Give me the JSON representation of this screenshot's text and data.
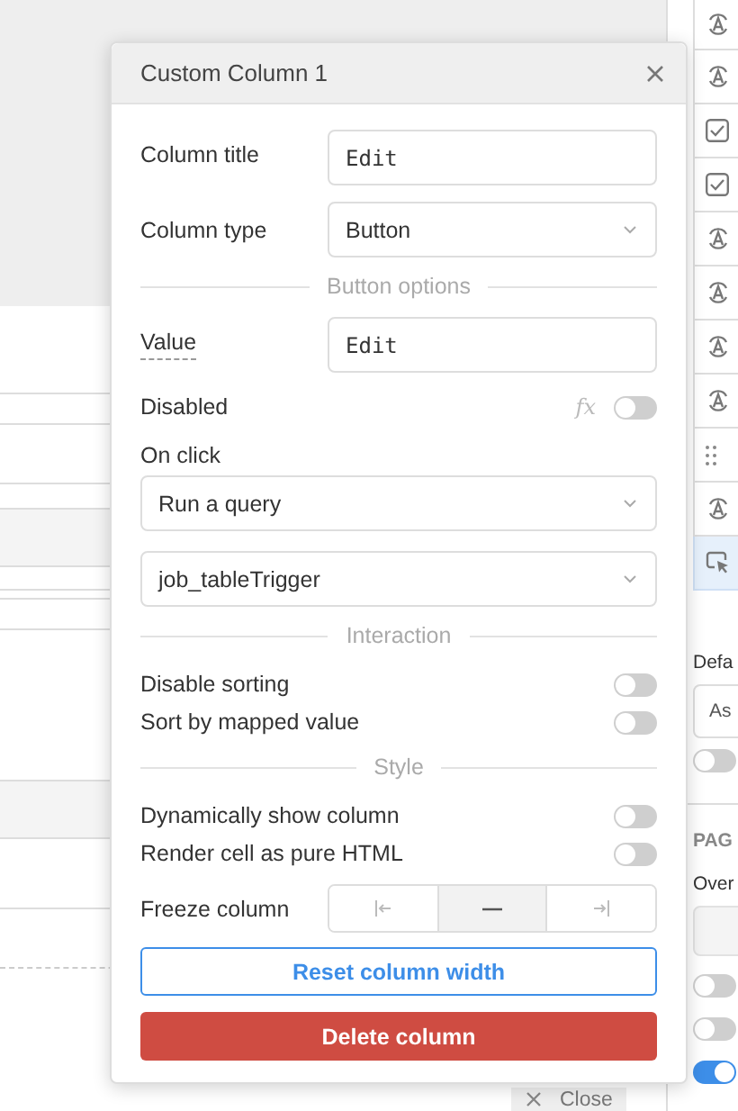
{
  "popup": {
    "title": "Custom Column 1",
    "rows": [
      {
        "kind": "input",
        "label": "Column title",
        "value": "Edit",
        "hint": false
      },
      {
        "kind": "select",
        "label": "Column type",
        "value": "Button"
      },
      {
        "kind": "section",
        "label": "Button options"
      },
      {
        "kind": "input",
        "label": "Value",
        "value": "Edit",
        "hint": true
      },
      {
        "kind": "toggle",
        "label": "Disabled",
        "on": false,
        "formula": "fx"
      },
      {
        "kind": "label",
        "label": "On click"
      },
      {
        "kind": "wide_select",
        "value": "Run a query"
      },
      {
        "kind": "wide_select",
        "value": "job_tableTrigger"
      },
      {
        "kind": "section",
        "label": "Interaction"
      },
      {
        "kind": "toggle",
        "label": "Disable sorting",
        "on": false
      },
      {
        "kind": "toggle",
        "label": "Sort by mapped value",
        "on": false
      },
      {
        "kind": "section",
        "label": "Style"
      },
      {
        "kind": "toggle",
        "label": "Dynamically show column",
        "on": false
      },
      {
        "kind": "toggle",
        "label": "Render cell as pure HTML",
        "on": false
      },
      {
        "kind": "segmented",
        "label": "Freeze column",
        "options": [
          {
            "selected": false
          },
          {
            "selected": true
          },
          {
            "selected": false
          }
        ]
      },
      {
        "kind": "outline_button",
        "label": "Reset column width"
      },
      {
        "kind": "danger_button",
        "label": "Delete column"
      }
    ]
  },
  "background": {
    "close_button": "Close"
  },
  "side_panel": {
    "column_items": [
      {
        "kind": "rotate",
        "selected": false
      },
      {
        "kind": "rotate",
        "selected": false
      },
      {
        "kind": "checkbox",
        "selected": false
      },
      {
        "kind": "checkbox",
        "selected": false
      },
      {
        "kind": "rotate",
        "selected": false
      },
      {
        "kind": "rotate",
        "selected": false
      },
      {
        "kind": "rotate",
        "selected": false
      },
      {
        "kind": "rotate",
        "selected": false
      },
      {
        "kind": "drag",
        "selected": false
      },
      {
        "kind": "rotate",
        "selected": false
      },
      {
        "kind": "cursor",
        "selected": true
      }
    ],
    "default_label": "Defa",
    "default_select": "As",
    "default_toggle": {
      "on": false
    },
    "section_heading": "PAG",
    "override_label": "Over",
    "toggles": [
      {
        "on": false
      },
      {
        "on": false
      },
      {
        "on": true
      }
    ]
  }
}
